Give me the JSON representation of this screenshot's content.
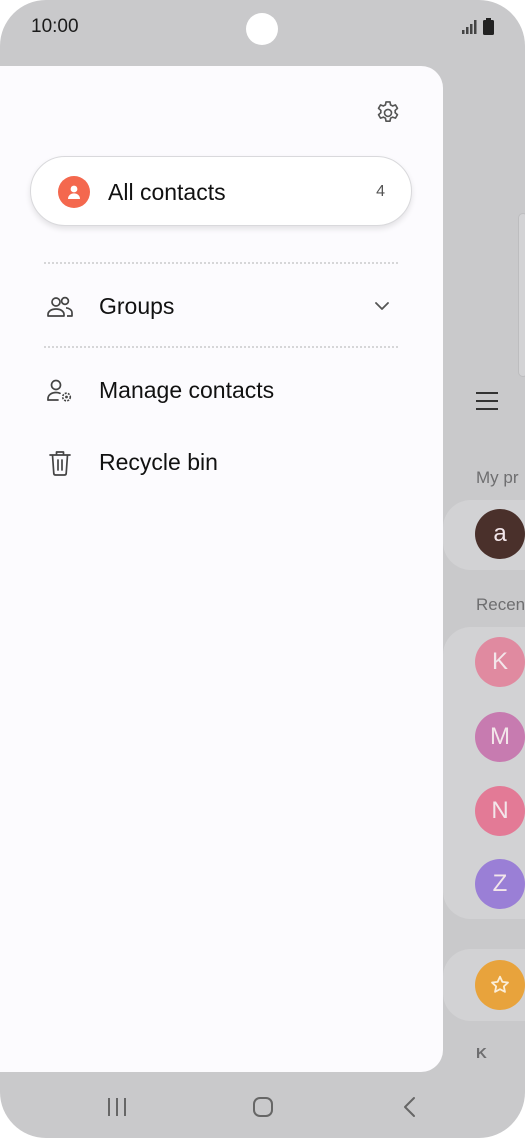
{
  "status_bar": {
    "time": "10:00"
  },
  "drawer": {
    "all_contacts": {
      "label": "All contacts",
      "count": "4",
      "icon": "person-icon",
      "accent": "#f4684e"
    },
    "items": [
      {
        "label": "Groups",
        "icon": "groups-icon",
        "expandable": true
      },
      {
        "label": "Manage contacts",
        "icon": "manage-contacts-icon"
      },
      {
        "label": "Recycle bin",
        "icon": "trash-icon"
      }
    ]
  },
  "background_app": {
    "section_my_profile": "My pr",
    "section_recent": "Recen",
    "profile_initial": "a",
    "recent_initials": [
      "K",
      "M",
      "N",
      "Z"
    ],
    "index_letter": "K",
    "colors": {
      "profile": "#4a302b",
      "K": "#e08aa0",
      "M": "#c77bb0",
      "N": "#e37a96",
      "Z": "#9a7fd6",
      "favorite": "#e8a33c"
    }
  }
}
